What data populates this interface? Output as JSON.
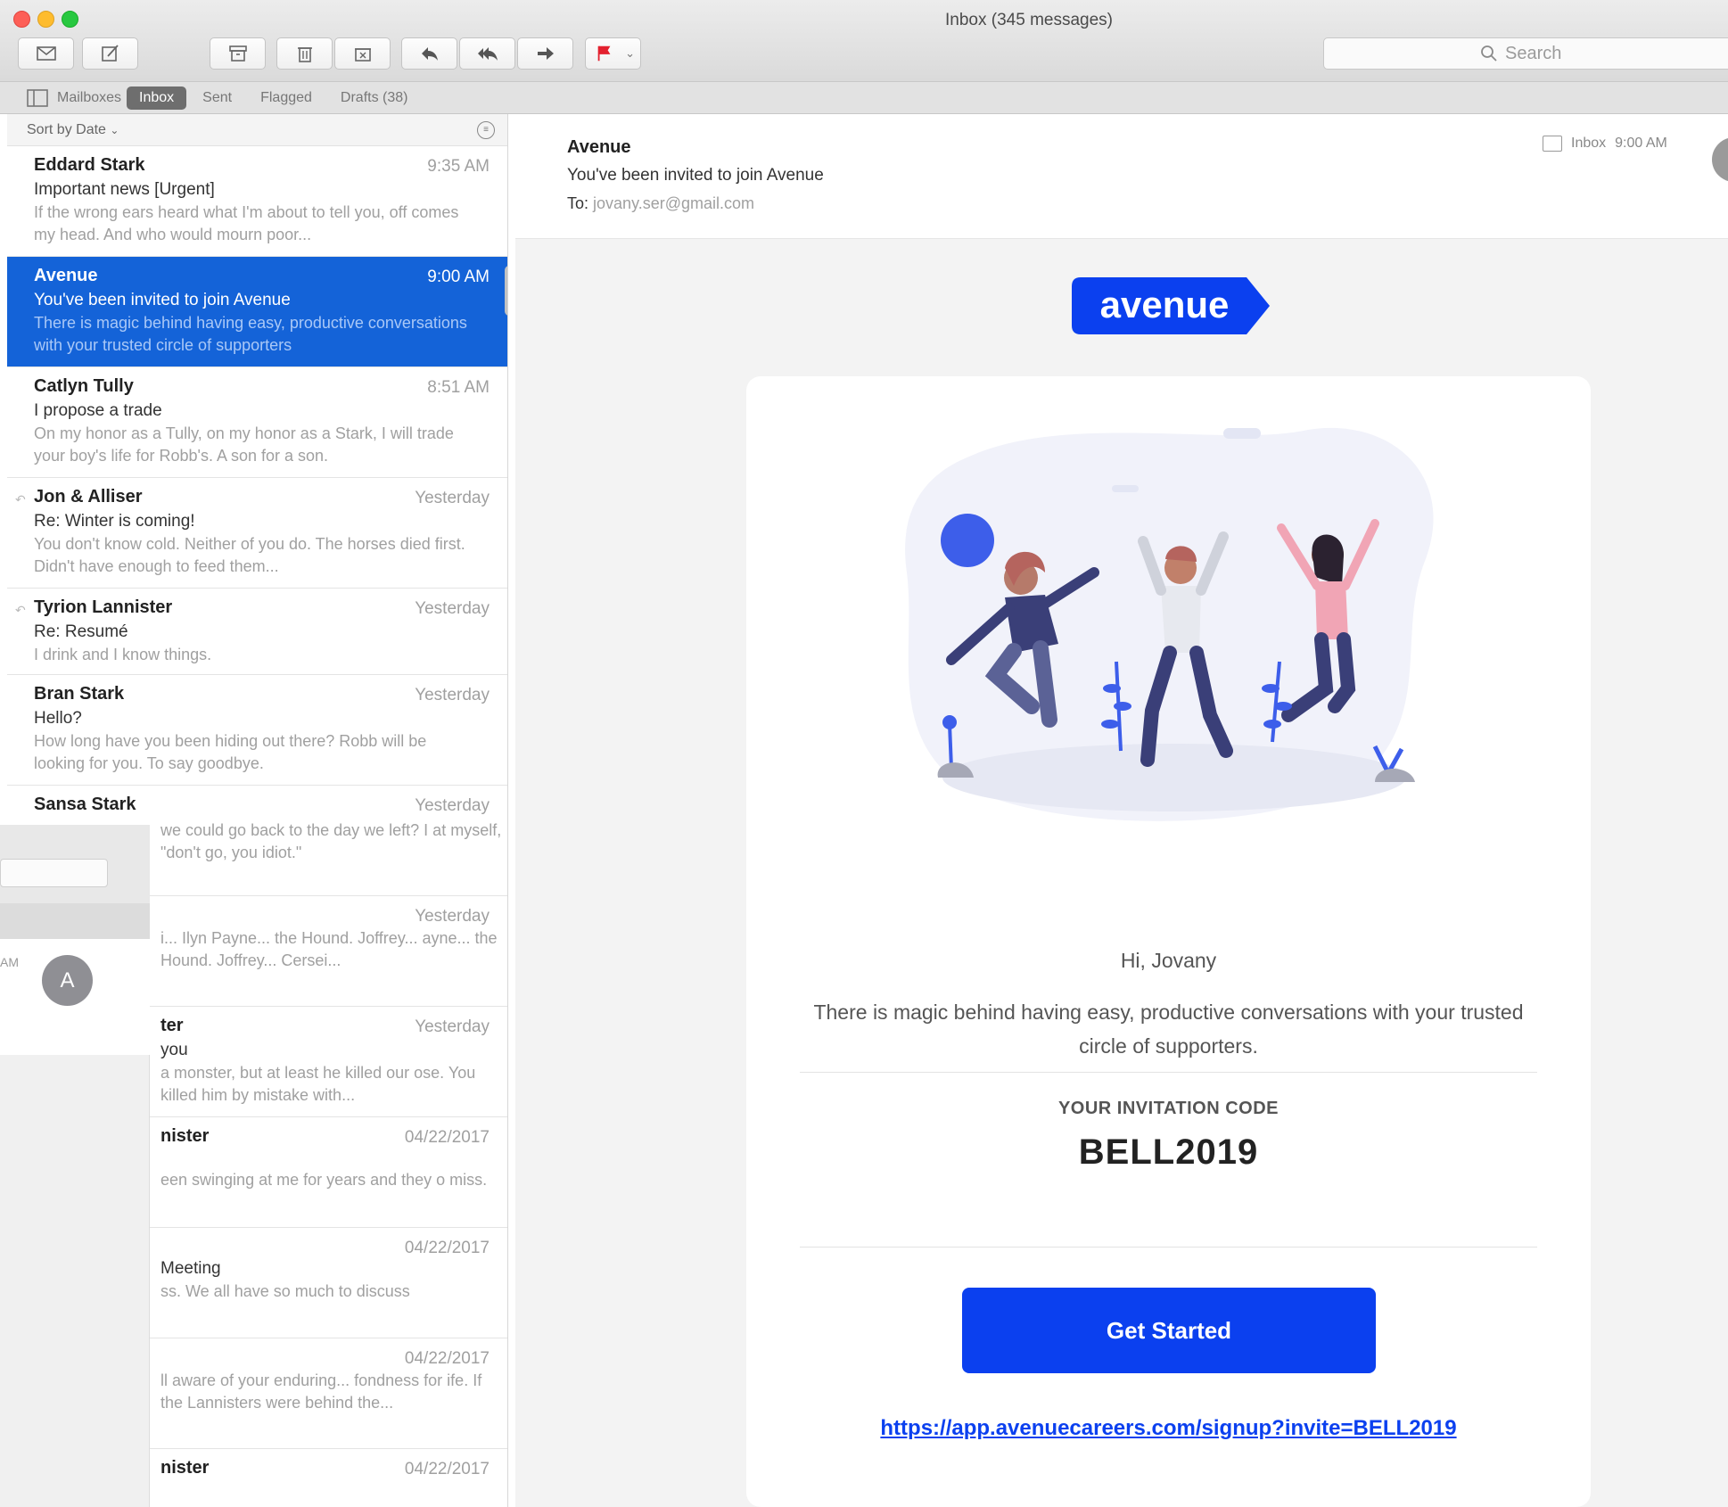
{
  "window": {
    "title": "Inbox (345 messages)"
  },
  "toolbar": {
    "search_placeholder": "Search"
  },
  "favorites": {
    "mailboxes": "Mailboxes",
    "items": [
      "Inbox",
      "Sent",
      "Flagged",
      "Drafts (38)"
    ]
  },
  "list": {
    "sort_label": "Sort by Date",
    "messages": [
      {
        "from": "Eddard Stark",
        "time": "9:35 AM",
        "subject": "Important news [Urgent]",
        "preview": "If the wrong ears heard what I'm about to tell you, off comes my head. And who would mourn poor..."
      },
      {
        "from": "Avenue",
        "time": "9:00 AM",
        "subject": "You've been invited to join Avenue",
        "preview": "There is magic behind having easy, productive conversations with your trusted circle of supporters"
      },
      {
        "from": "Catlyn Tully",
        "time": "8:51 AM",
        "subject": "I propose a trade",
        "preview": "On my honor as a Tully, on my honor as a Stark, I will trade your boy's life for Robb's. A son for a son."
      },
      {
        "from": "Jon & Alliser",
        "time": "Yesterday",
        "subject": "Re: Winter is coming!",
        "preview": "You don't know cold. Neither of you do. The horses died first. Didn't have enough to feed them..."
      },
      {
        "from": "Tyrion Lannister",
        "time": "Yesterday",
        "subject": "Re: Resumé",
        "preview": "I drink and I know things."
      },
      {
        "from": "Bran Stark",
        "time": "Yesterday",
        "subject": "Hello?",
        "preview": "How long have you been hiding out there? Robb will be looking for you. To say goodbye."
      },
      {
        "from": "Sansa Stark",
        "time": "Yesterday",
        "subject": "",
        "preview": "we could go back to the day we left? I at myself, \"don't go, you idiot.\""
      },
      {
        "from": "",
        "time": "Yesterday",
        "subject": "",
        "preview": "i... Ilyn Payne... the Hound. Joffrey... ayne... the Hound. Joffrey... Cersei..."
      },
      {
        "from": "ter",
        "time": "Yesterday",
        "subject": "you",
        "preview": "a monster, but at least he killed our ose. You killed him by mistake with..."
      },
      {
        "from": "nister",
        "time": "04/22/2017",
        "subject": "",
        "preview": "een swinging at me for years and they o miss."
      },
      {
        "from": "",
        "time": "04/22/2017",
        "subject": "Meeting",
        "preview": "ss. We all have so much to discuss"
      },
      {
        "from": "",
        "time": "04/22/2017",
        "subject": "",
        "preview": "ll aware of your enduring... fondness for ife. If the Lannisters were behind the..."
      },
      {
        "from": "nister",
        "time": "04/22/2017",
        "subject": "",
        "preview": ""
      }
    ]
  },
  "ghost_window": {
    "time_fragment": "AM",
    "avatar_letter": "A"
  },
  "reader": {
    "sender": "Avenue",
    "subject": "You've been invited to join Avenue",
    "to_label": "To:",
    "to_address": "jovany.ser@gmail.com",
    "mailbox": "Inbox",
    "time": "9:00 AM"
  },
  "email": {
    "logo_text": "avenue",
    "greeting": "Hi, Jovany",
    "body": "There is magic behind having easy, productive conversations with your trusted circle of supporters.",
    "code_label": "YOUR INVITATION CODE",
    "code": "BELL2019",
    "cta": "Get Started",
    "link": "https://app.avenuecareers.com/signup?invite=BELL2019"
  },
  "colors": {
    "brand_blue": "#0b40ef",
    "selection_blue": "#1463d8",
    "flag_red": "#e3212f"
  }
}
